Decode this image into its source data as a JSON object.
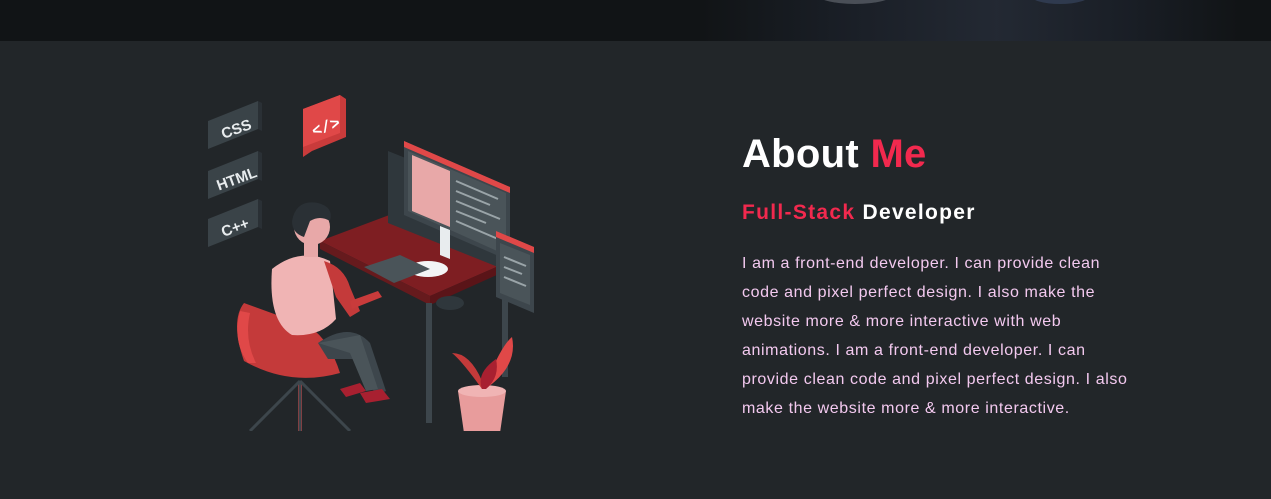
{
  "about": {
    "title_main": "About",
    "title_accent": "Me",
    "subtitle_accent": "Full-Stack",
    "subtitle_main": "Developer",
    "description": "I am a front-end developer. I can provide clean code and pixel perfect design. I also make the website more & more interactive with web animations. I am a front-end developer. I can provide clean code and pixel perfect design. I also make the website more & more interactive.",
    "illustration": {
      "tags": [
        "CSS",
        "HTML",
        "C++"
      ],
      "code_badge": "</>"
    }
  },
  "colors": {
    "background": "#222629",
    "header_strip": "#111416",
    "accent": "#f2294e",
    "text": "#ffffff",
    "description_text": "#f3c9ef"
  }
}
